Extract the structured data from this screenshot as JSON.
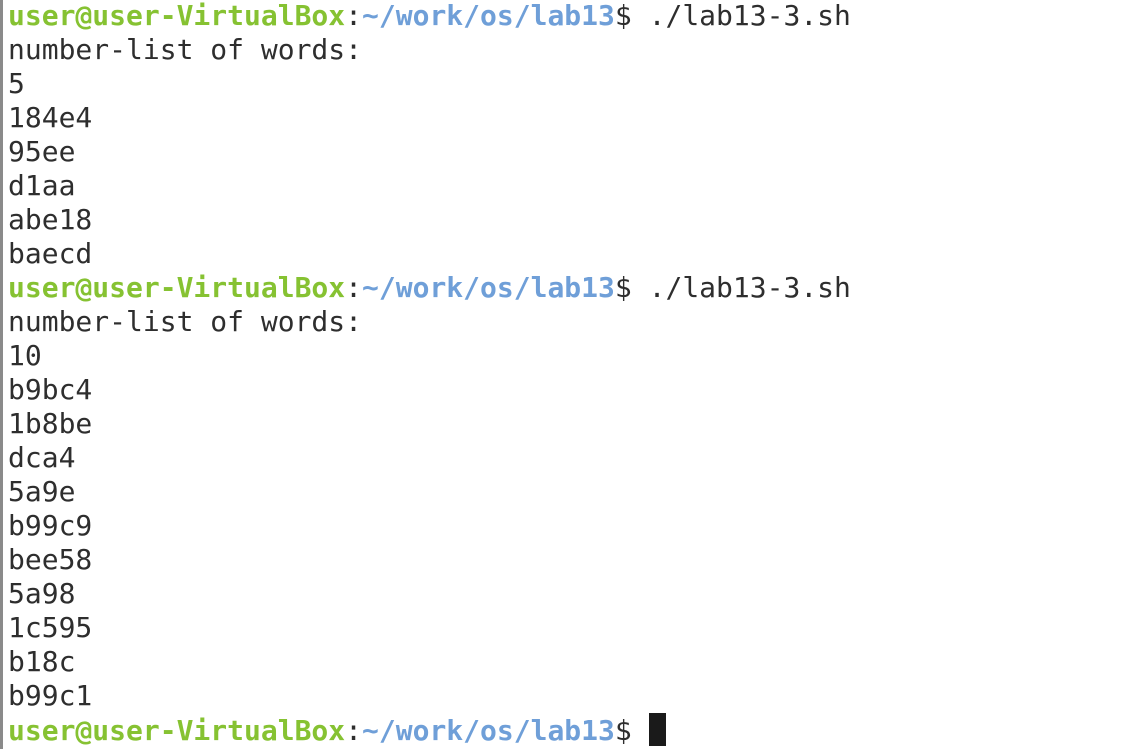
{
  "prompt": {
    "user_host": "user@user-VirtualBox",
    "separator": ":",
    "path": "~/work/os/lab13",
    "symbol": "$"
  },
  "sessions": [
    {
      "command": " ./lab13-3.sh",
      "header": "number-list of words:",
      "count": "5",
      "words": [
        "184e4",
        "95ee",
        "d1aa",
        "abe18",
        "baecd"
      ]
    },
    {
      "command": " ./lab13-3.sh",
      "header": "number-list of words:",
      "count": "10",
      "words": [
        "b9bc4",
        "1b8be",
        "dca4",
        "5a9e",
        "b99c9",
        "bee58",
        "5a98",
        "1c595",
        "b18c",
        "b99c1"
      ]
    }
  ],
  "final_input": " "
}
